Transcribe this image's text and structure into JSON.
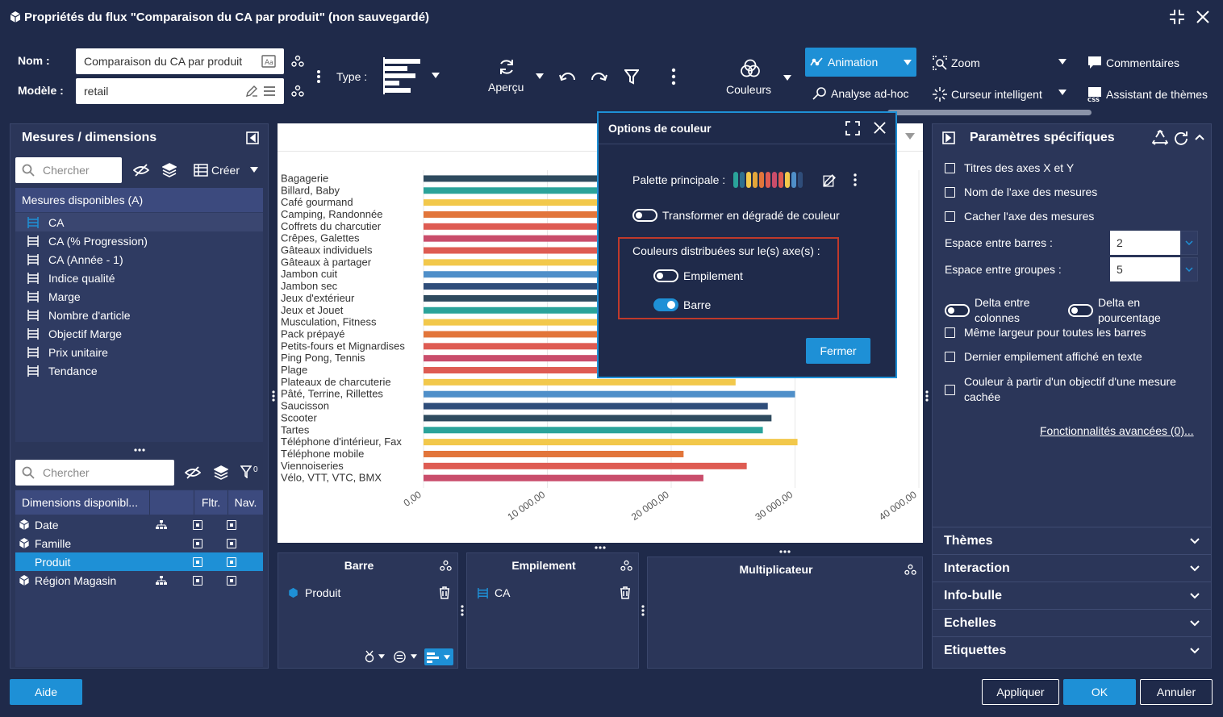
{
  "window": {
    "title": "Propriétés du flux \"Comparaison du CA par produit\" (non sauvegardé)"
  },
  "form": {
    "nom_label": "Nom :",
    "nom_value": "Comparaison du CA par produit",
    "modele_label": "Modèle :",
    "modele_value": "retail",
    "type_label": "Type :"
  },
  "toolbar": {
    "apercu": "Aperçu",
    "couleurs": "Couleurs",
    "animation": "Animation",
    "analyse": "Analyse ad-hoc",
    "zoom": "Zoom",
    "curseur": "Curseur intelligent",
    "commentaires": "Commentaires",
    "assistant": "Assistant de thèmes"
  },
  "left_panel": {
    "title": "Mesures / dimensions",
    "search_placeholder": "Chercher",
    "creer": "Créer",
    "measures_header": "Mesures disponibles (A)",
    "measures": [
      "CA",
      "CA (% Progression)",
      "CA (Année - 1)",
      "Indice qualité",
      "Marge",
      "Nombre d'article",
      "Objectif Marge",
      "Prix unitaire",
      "Tendance"
    ],
    "dim_search_placeholder": "Chercher",
    "dim_filter_count": "0",
    "dims_header": "Dimensions disponibl...",
    "col_fltr": "Fltr.",
    "col_nav": "Nav.",
    "dimensions": [
      {
        "label": "Date",
        "hierarchy": true,
        "fltr": true,
        "nav": true,
        "selected": false
      },
      {
        "label": "Famille",
        "hierarchy": false,
        "fltr": true,
        "nav": true,
        "selected": false
      },
      {
        "label": "Produit",
        "hierarchy": false,
        "fltr": true,
        "nav": true,
        "selected": true
      },
      {
        "label": "Région Magasin",
        "hierarchy": true,
        "fltr": true,
        "nav": true,
        "selected": false
      }
    ]
  },
  "chart_data": {
    "type": "bar",
    "orientation": "horizontal",
    "categories": [
      "Bagagerie",
      "Billard, Baby",
      "Café gourmand",
      "Camping, Randonnée",
      "Coffrets du charcutier",
      "Crêpes, Galettes",
      "Gâteaux individuels",
      "Gâteaux à partager",
      "Jambon cuit",
      "Jambon sec",
      "Jeux d'extérieur",
      "Jeux et Jouet",
      "Musculation, Fitness",
      "Pack prépayé",
      "Petits-fours et Mignardises",
      "Ping Pong, Tennis",
      "Plage",
      "Plateaux de charcuterie",
      "Pâté, Terrine, Rillettes",
      "Saucisson",
      "Scooter",
      "Tartes",
      "Téléphone d'intérieur, Fax",
      "Téléphone mobile",
      "Viennoiseries",
      "Vélo, VTT, VTC, BMX"
    ],
    "values": [
      29500,
      30800,
      26500,
      28000,
      29000,
      27500,
      30000,
      31000,
      26000,
      29500,
      27000,
      28500,
      30500,
      26000,
      29000,
      27500,
      30000,
      25200,
      30000,
      27800,
      28100,
      27400,
      30200,
      21000,
      26100,
      22600
    ],
    "colors": [
      "#2e4a5e",
      "#2aa39a",
      "#f2c84b",
      "#e2753a",
      "#de5b52",
      "#c94d6b",
      "#de5b52",
      "#f2c84b",
      "#4f8fc9",
      "#2f4d7a",
      "#2e4a5e",
      "#2aa39a",
      "#f2c84b",
      "#e2753a",
      "#de5b52",
      "#c94d6b",
      "#de5b52",
      "#f2c84b",
      "#4f8fc9",
      "#2f4d7a",
      "#2e4a5e",
      "#2aa39a",
      "#f2c84b",
      "#e2753a",
      "#de5b52",
      "#c94d6b"
    ],
    "xlim": [
      0,
      40000
    ],
    "xticks": [
      "0,00",
      "10 000,00",
      "20 000,00",
      "30 000,00",
      "40 000,00"
    ],
    "grid": true
  },
  "color_dialog": {
    "title": "Options de couleur",
    "palette_label": "Palette principale :",
    "palette": [
      "#2aa39a",
      "#2e6f8e",
      "#f2c84b",
      "#e2a53a",
      "#e2753a",
      "#de5b52",
      "#c94d6b",
      "#de5b52",
      "#f2c84b",
      "#4f8fc9",
      "#2f4d7a"
    ],
    "gradient_label": "Transformer en dégradé de couleur",
    "distributed_label": "Couleurs distribuées sur le(s) axe(s) :",
    "empilement": "Empilement",
    "barre": "Barre",
    "fermer": "Fermer"
  },
  "zones": {
    "barre": "Barre",
    "barre_item": "Produit",
    "empilement": "Empilement",
    "empilement_item": "CA",
    "multiplicateur": "Multiplicateur"
  },
  "right_panel": {
    "title": "Paramètres spécifiques",
    "titres_axes": "Titres des axes X et Y",
    "nom_axe": "Nom de l'axe des mesures",
    "cacher_axe": "Cacher l'axe des mesures",
    "espace_barres": "Espace entre barres :",
    "espace_barres_value": "2",
    "espace_groupes": "Espace entre groupes :",
    "espace_groupes_value": "5",
    "delta_colonnes": "Delta entre colonnes",
    "delta_pourcentage": "Delta en pourcentage",
    "meme_largeur": "Même largeur pour toutes les barres",
    "dernier_empilement": "Dernier empilement affiché en texte",
    "couleur_objectif": "Couleur à partir d'un objectif d'une mesure cachée",
    "fonctionnalites": "Fonctionnalités avancées (0)...",
    "sections": [
      "Thèmes",
      "Interaction",
      "Info-bulle",
      "Echelles",
      "Etiquettes"
    ]
  },
  "footer": {
    "aide": "Aide",
    "appliquer": "Appliquer",
    "ok": "OK",
    "annuler": "Annuler"
  }
}
